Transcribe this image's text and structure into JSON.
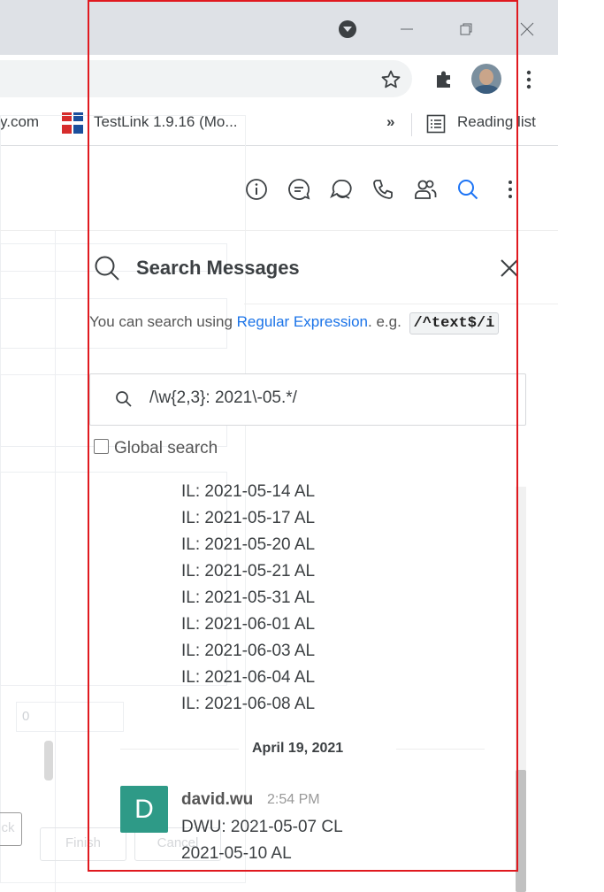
{
  "browser": {
    "bookmarks": [
      {
        "label": "y.com"
      },
      {
        "label": "TestLink 1.9.16 (Mo..."
      }
    ],
    "more_bookmarks": "»",
    "reading_list": "Reading list"
  },
  "background_app": {
    "field_value": "0",
    "buttons": {
      "back": "ck",
      "finish": "Finish",
      "cancel": "Cancel"
    }
  },
  "chat_header": {
    "icons": [
      "info-icon",
      "threads-icon",
      "discussion-icon",
      "call-icon",
      "members-icon",
      "search-icon",
      "kebab-menu-icon"
    ]
  },
  "search_panel": {
    "title": "Search Messages",
    "hint_prefix": "You can search using ",
    "hint_link": "Regular Expression",
    "hint_mid": ". e.g. ",
    "hint_code": "/^text$/i",
    "query": "/\\w{2,3}: 2021\\-05.*/",
    "global_search_label": "Global search",
    "global_search_checked": false
  },
  "results": {
    "lines": [
      "IL: 2021-05-14 AL",
      "IL: 2021-05-17 AL",
      "IL: 2021-05-20 AL",
      "IL: 2021-05-21 AL",
      "IL: 2021-05-31 AL",
      "IL: 2021-06-01 AL",
      "IL: 2021-06-03 AL",
      "IL: 2021-06-04 AL",
      "IL: 2021-06-08 AL"
    ],
    "date_separator": "April 19, 2021",
    "message": {
      "avatar_letter": "D",
      "avatar_color": "#2e9a87",
      "author": "david.wu",
      "time": "2:54 PM",
      "lines": [
        "DWU: 2021-05-07 CL",
        "2021-05-10 AL"
      ]
    }
  },
  "colors": {
    "accent_link": "#1a73e8",
    "highlight_frame": "#e0191f"
  }
}
